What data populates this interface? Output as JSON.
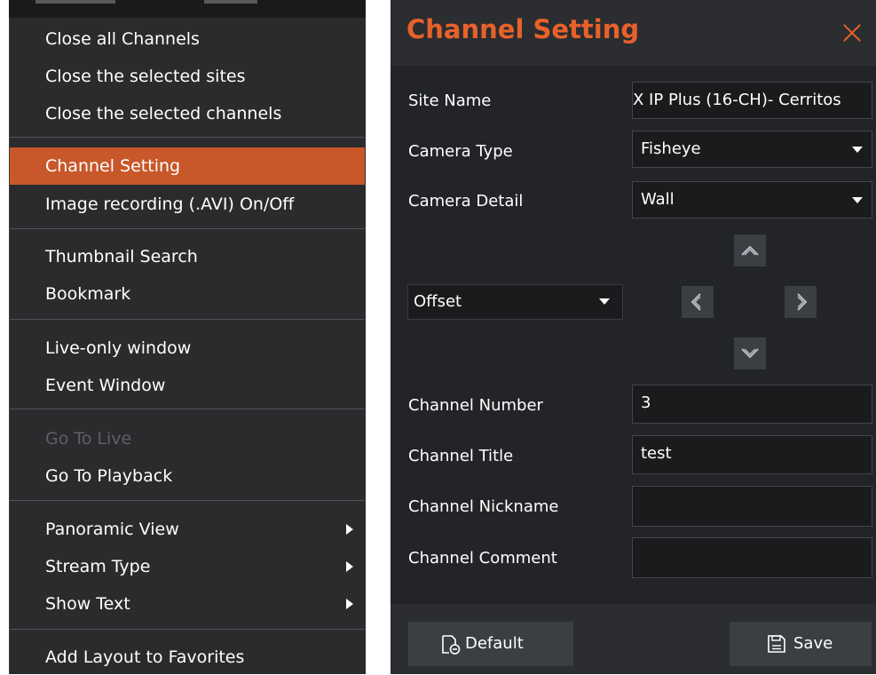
{
  "context_menu": {
    "items": [
      {
        "label": "Close all Channels"
      },
      {
        "label": "Close the selected sites"
      },
      {
        "label": "Close the selected channels"
      },
      {
        "label": "Channel Setting",
        "state": "highlighted"
      },
      {
        "label": "Image recording (.AVI) On/Off"
      },
      {
        "label": "Thumbnail Search"
      },
      {
        "label": "Bookmark"
      },
      {
        "label": "Live-only window"
      },
      {
        "label": "Event Window"
      },
      {
        "label": "Go To Live",
        "state": "disabled"
      },
      {
        "label": "Go To Playback"
      },
      {
        "label": "Panoramic View",
        "submenu": true
      },
      {
        "label": "Stream Type",
        "submenu": true
      },
      {
        "label": "Show Text",
        "submenu": true
      },
      {
        "label": "Add Layout to Favorites"
      }
    ]
  },
  "dialog": {
    "title": "Channel Setting",
    "fields": {
      "site_name": {
        "label": "Site Name",
        "value": "X IP Plus (16-CH)- Cerritos"
      },
      "camera_type": {
        "label": "Camera Type",
        "value": "Fisheye"
      },
      "camera_detail": {
        "label": "Camera Detail",
        "value": "Wall"
      },
      "offset": {
        "value": "Offset"
      },
      "channel_number": {
        "label": "Channel Number",
        "value": "3"
      },
      "channel_title": {
        "label": "Channel Title",
        "value": "test"
      },
      "channel_nickname": {
        "label": "Channel Nickname",
        "value": ""
      },
      "channel_comment": {
        "label": "Channel Comment",
        "value": ""
      }
    },
    "buttons": {
      "default_label": "Default",
      "save_label": "Save"
    }
  },
  "colors": {
    "accent": "#e8612a",
    "menu_bg": "#2a2b2d",
    "menu_highlight": "#c8572a",
    "dialog_body_bg": "#222427"
  },
  "icons": [
    "close-icon",
    "dropdown-arrow-icon",
    "submenu-arrow-icon",
    "pan-up-icon",
    "pan-left-icon",
    "pan-right-icon",
    "pan-down-icon",
    "default-reset-icon",
    "save-icon"
  ]
}
